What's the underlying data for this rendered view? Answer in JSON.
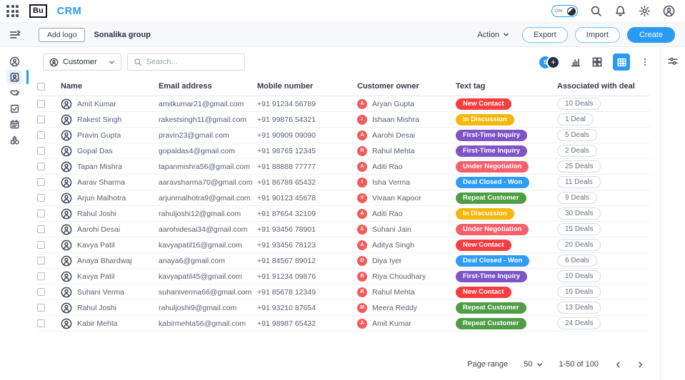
{
  "app": {
    "brand": "Bu",
    "title": "CRM",
    "dark_toggle_label": "ON"
  },
  "header": {
    "add_logo_label": "Add logo",
    "group_name": "Sonalika group",
    "action_label": "Action",
    "export_label": "Export",
    "import_label": "Import",
    "create_label": "Create"
  },
  "sidebar": {
    "items": [
      {
        "icon": "contacts-icon",
        "active": false
      },
      {
        "icon": "customers-icon",
        "active": true
      },
      {
        "icon": "deals-icon",
        "active": false
      },
      {
        "icon": "tasks-icon",
        "active": false
      },
      {
        "icon": "calendar-icon",
        "active": false
      },
      {
        "icon": "products-icon",
        "active": false
      }
    ]
  },
  "toolbar": {
    "entity_selector_value": "Customer",
    "search_placeholder": "Search...",
    "avatar_initial": "S",
    "add_member_glyph": "+",
    "icons": [
      "chart-icon",
      "kanban-view-icon",
      "table-view-icon",
      "kebab-menu-icon",
      "filter-icon"
    ]
  },
  "table": {
    "columns": [
      "Name",
      "Email address",
      "Mobile number",
      "Customer owner",
      "Text tag",
      "Associated with deal"
    ],
    "rows": [
      {
        "name": "Amit Kumar",
        "email": "amitkumar21@gmail.com",
        "mobile": "+91 91234 56789",
        "owner_initial": "A",
        "owner": "Aryan Gupta",
        "tag": "New Contact",
        "deals": "10 Deals"
      },
      {
        "name": "Rakest Singh",
        "email": "rakestsingh11@gmail.com",
        "mobile": "+91 99876 54321",
        "owner_initial": "I",
        "owner": "Ishaan Mishra",
        "tag": "In Discussion",
        "deals": "1 Deal"
      },
      {
        "name": "Pravin Gupta",
        "email": "pravin23@gmail.com",
        "mobile": "+91 90909 09090",
        "owner_initial": "A",
        "owner": "Aarohi Desai",
        "tag": "First-Time Inquiry",
        "deals": "5 Deals"
      },
      {
        "name": "Gopal Das",
        "email": "gopaldas4@gmail.com",
        "mobile": "+91 98765 12345",
        "owner_initial": "R",
        "owner": "Rahul Mehta",
        "tag": "First-Time Inquiry",
        "deals": "2 Deals"
      },
      {
        "name": "Tapan Mishra",
        "email": "tapanmishra56@gmail.com",
        "mobile": "+91 88888 77777",
        "owner_initial": "A",
        "owner": "Aditi Rao",
        "tag": "Under Negotiation",
        "deals": "25 Deals"
      },
      {
        "name": "Aarav Sharma",
        "email": "aaravsharma70@gmail.com",
        "mobile": "+91 86789 65432",
        "owner_initial": "I",
        "owner": "Isha Verma",
        "tag": "Deal Closed - Won",
        "deals": "11 Deals"
      },
      {
        "name": "Arjun Malhotra",
        "email": "arjunmalhotra9@gmail.com",
        "mobile": "+91 90123 45678",
        "owner_initial": "V",
        "owner": "Vivaan Kapoor",
        "tag": "Repeat Customer",
        "deals": "9 Deals"
      },
      {
        "name": "Rahul Joshi",
        "email": "rahuljoshi12@gmail.com",
        "mobile": "+91 87654 32109",
        "owner_initial": "A",
        "owner": "Aditi Rao",
        "tag": "In Discussion",
        "deals": "30 Deals"
      },
      {
        "name": "Aarohi Desai",
        "email": "aarohidesai34@gmail.com",
        "mobile": "+91 93456 78901",
        "owner_initial": "S",
        "owner": "Suhani Jain",
        "tag": "Under Negotiation",
        "deals": "15 Deals"
      },
      {
        "name": "Kavya Patil",
        "email": "kavyapatil16@gmail.com",
        "mobile": "+91 93456 78123",
        "owner_initial": "A",
        "owner": "Aditya Singh",
        "tag": "New Contact",
        "deals": "20 Deals"
      },
      {
        "name": "Anaya Bhardwaj",
        "email": "anaya6@gmail.com",
        "mobile": "+91 84567 89012",
        "owner_initial": "D",
        "owner": "Diya Iyer",
        "tag": "Deal Closed - Won",
        "deals": "6 Deals"
      },
      {
        "name": "Kavya Patil",
        "email": "kavyapatil45@gmail.com",
        "mobile": "+91 91234 09876",
        "owner_initial": "R",
        "owner": "Riya Choudhary",
        "tag": "First-Time Inquiry",
        "deals": "10 Deals"
      },
      {
        "name": "Suhani Verma",
        "email": "suhaniverma66@gmail.com",
        "mobile": "+91 85678 12349",
        "owner_initial": "R",
        "owner": "Rahul Mehta",
        "tag": "New Contact",
        "deals": "16 Deals"
      },
      {
        "name": "Rahul Joshi",
        "email": "rahuljoshi9@gmail.com",
        "mobile": "+91 93210 87654",
        "owner_initial": "M",
        "owner": "Meera Reddy",
        "tag": "Repeat Customer",
        "deals": "13 Deals"
      },
      {
        "name": "Kabir Mehta",
        "email": "kabirmehta56@gmail.com",
        "mobile": "+91 98987 65432",
        "owner_initial": "A",
        "owner": "Amit Kumar",
        "tag": "Repeat Customer",
        "deals": "24 Deals"
      }
    ]
  },
  "tag_colors": {
    "New Contact": "#f63e3e",
    "In Discussion": "#f6b70b",
    "First-Time Inquiry": "#7d55c7",
    "Under Negotiation": "#f5606c",
    "Deal Closed - Won": "#2d9cf4",
    "Repeat Customer": "#4f9d45"
  },
  "colors": {
    "accent": "#2b9af3",
    "owner_avatar": "#f45c5c"
  },
  "pagination": {
    "label": "Page range",
    "page_size": "50",
    "range_text": "1-50 of 100"
  }
}
